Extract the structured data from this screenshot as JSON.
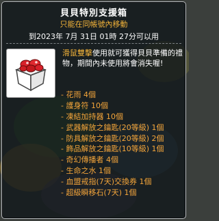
{
  "tooltip": {
    "title": "貝貝特別支援箱",
    "subtitle": "只能在同帳號內移動",
    "expiry": "到2023年 7月 31日 01時 27分可以用",
    "description_highlight": "滑鼠雙擊",
    "description_rest": "使用就可獲得貝貝準備的禮物，期間內未使用將會消失喔!",
    "items": [
      "- 花雨 4個",
      "- 護身符 10個",
      "- 凍結加持器 10個",
      "- 武器解放之鑰匙(20等級) 1個",
      "- 防具解放之鑰匙(20等級) 2個",
      "- 飾品解放之鑰匙(10等級) 1個",
      "- 奇幻傳播者 4個",
      "- 生命之水 1個",
      "- 血盟戒指(7天)交換券 1個",
      "- 超級瞬移石(7天) 1個"
    ],
    "icon": "gift-box-with-red-ribbon-icon"
  },
  "colors": {
    "accent_orange": "#f4a53a",
    "text_white": "#ffffff",
    "panel_bg": "#12181a"
  }
}
